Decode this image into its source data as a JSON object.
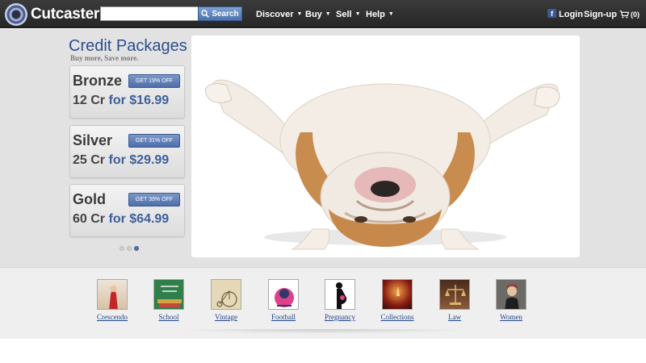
{
  "brand": {
    "name": "Cutcaster"
  },
  "search": {
    "placeholder": "",
    "button_label": "Search"
  },
  "nav": {
    "discover": "Discover",
    "buy": "Buy",
    "sell": "Sell",
    "help": "Help",
    "login": "Login",
    "signup": "Sign-up",
    "cart_count": "(0)"
  },
  "packages": {
    "title": "Credit Packages",
    "subtitle": "Buy more, Save more.",
    "items": [
      {
        "name": "Bronze",
        "badge": "GET 19% OFF",
        "credits": "12 Cr",
        "for": "for",
        "price": "$16.99"
      },
      {
        "name": "Silver",
        "badge": "GET 31% OFF",
        "credits": "25 Cr",
        "for": "for",
        "price": "$29.99"
      },
      {
        "name": "Gold",
        "badge": "GET 39% OFF",
        "credits": "60 Cr",
        "for": "for",
        "price": "$64.99"
      }
    ],
    "carousel": {
      "pages": 3,
      "active": 3
    }
  },
  "categories": [
    {
      "label": "Crescendo"
    },
    {
      "label": "School"
    },
    {
      "label": "Vintage"
    },
    {
      "label": "Football"
    },
    {
      "label": "Pregnancy"
    },
    {
      "label": "Collections"
    },
    {
      "label": "Law"
    },
    {
      "label": "Women"
    }
  ],
  "colors": {
    "topbar": "#2f2f2f",
    "accent": "#2b4f8f",
    "badge": "#5a7ab4",
    "link": "#22448a"
  }
}
